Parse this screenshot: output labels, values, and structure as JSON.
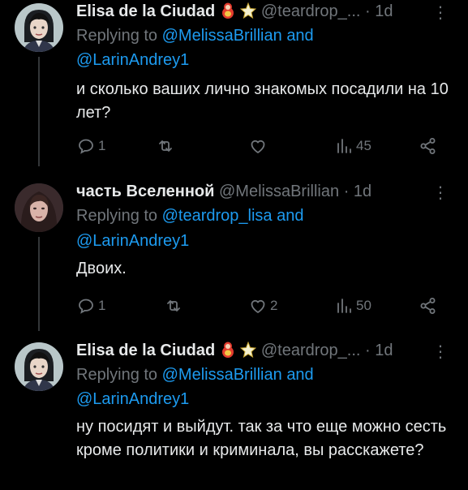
{
  "tweets": [
    {
      "name": "Elisa de la Ciudad",
      "handle": "@teardrop_...",
      "dot": "·",
      "time": "1d",
      "replying_prefix": "Replying to",
      "replying_mention_1": "@MelissaBrillian",
      "replying_and": "and",
      "replying_mention_2": "@LarinAndrey1",
      "text": "и сколько ваших лично знакомых посадили на 10 лет?",
      "replies": "1",
      "retweets": "",
      "likes": "",
      "views": "45"
    },
    {
      "name": "часть Вселенной",
      "handle": "@MelissaBrillian",
      "dot": "·",
      "time": "1d",
      "replying_prefix": "Replying to",
      "replying_mention_1": "@teardrop_lisa",
      "replying_and": "and",
      "replying_mention_2": "@LarinAndrey1",
      "text": "Двоих.",
      "replies": "1",
      "retweets": "",
      "likes": "2",
      "views": "50"
    },
    {
      "name": "Elisa de la Ciudad",
      "handle": "@teardrop_...",
      "dot": "·",
      "time": "1d",
      "replying_prefix": "Replying to",
      "replying_mention_1": "@MelissaBrillian",
      "replying_and": "and",
      "replying_mention_2": "@LarinAndrey1",
      "text": "ну посидят и выйдут. так за что еще можно сесть кроме политики и криминала, вы расскажете?"
    }
  ],
  "colors": {
    "background": "#000000",
    "text": "#e7e9ea",
    "muted": "#71767b",
    "link": "#1d9bf0"
  }
}
